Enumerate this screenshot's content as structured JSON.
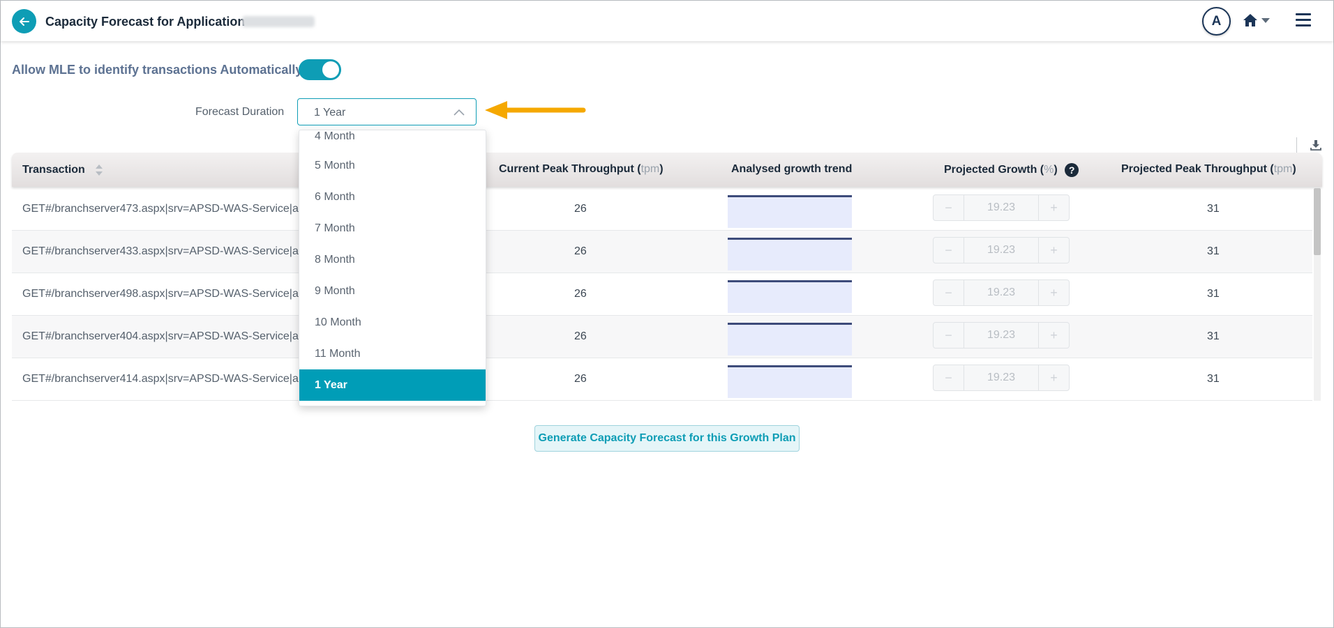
{
  "header": {
    "title": "Capacity Forecast for Application-",
    "avatar_initial": "A"
  },
  "mle": {
    "label": "Allow MLE to identify transactions Automatically",
    "enabled": true
  },
  "forecast_duration": {
    "label": "Forecast Duration",
    "selected": "1 Year",
    "options": [
      "4 Month",
      "5 Month",
      "6 Month",
      "7 Month",
      "8 Month",
      "9 Month",
      "10 Month",
      "11 Month",
      "1 Year"
    ]
  },
  "table": {
    "columns": {
      "transaction": "Transaction",
      "current_peak": "Current Peak Throughput (",
      "current_peak_unit": "tpm",
      "current_peak_close": ")",
      "trend": "Analysed growth trend",
      "projected_growth": "Projected Growth (",
      "projected_growth_unit": "%",
      "projected_growth_close": ")",
      "projected_peak": "Projected Peak Throughput (",
      "projected_peak_unit": "tpm",
      "projected_peak_close": ")"
    },
    "rows": [
      {
        "transaction": "GET#/branchserver473.aspx|srv=APSD-WAS-Service|a",
        "current_peak": "26",
        "growth": "19.23",
        "projected_peak": "31"
      },
      {
        "transaction": "GET#/branchserver433.aspx|srv=APSD-WAS-Service|a",
        "current_peak": "26",
        "growth": "19.23",
        "projected_peak": "31"
      },
      {
        "transaction": "GET#/branchserver498.aspx|srv=APSD-WAS-Service|a",
        "current_peak": "26",
        "growth": "19.23",
        "projected_peak": "31"
      },
      {
        "transaction": "GET#/branchserver404.aspx|srv=APSD-WAS-Service|a",
        "current_peak": "26",
        "growth": "19.23",
        "projected_peak": "31"
      },
      {
        "transaction": "GET#/branchserver414.aspx|srv=APSD-WAS-Service|a",
        "current_peak": "26",
        "growth": "19.23",
        "projected_peak": "31"
      }
    ],
    "stepper_minus": "−",
    "stepper_plus": "+"
  },
  "generate_button": "Generate Capacity Forecast for this Growth Plan",
  "colors": {
    "accent": "#0e9db5",
    "selected_option": "#009db7",
    "annotation_arrow": "#f5a800",
    "trend_fill": "#e7ebfc",
    "trend_line": "#3d4b7a"
  }
}
